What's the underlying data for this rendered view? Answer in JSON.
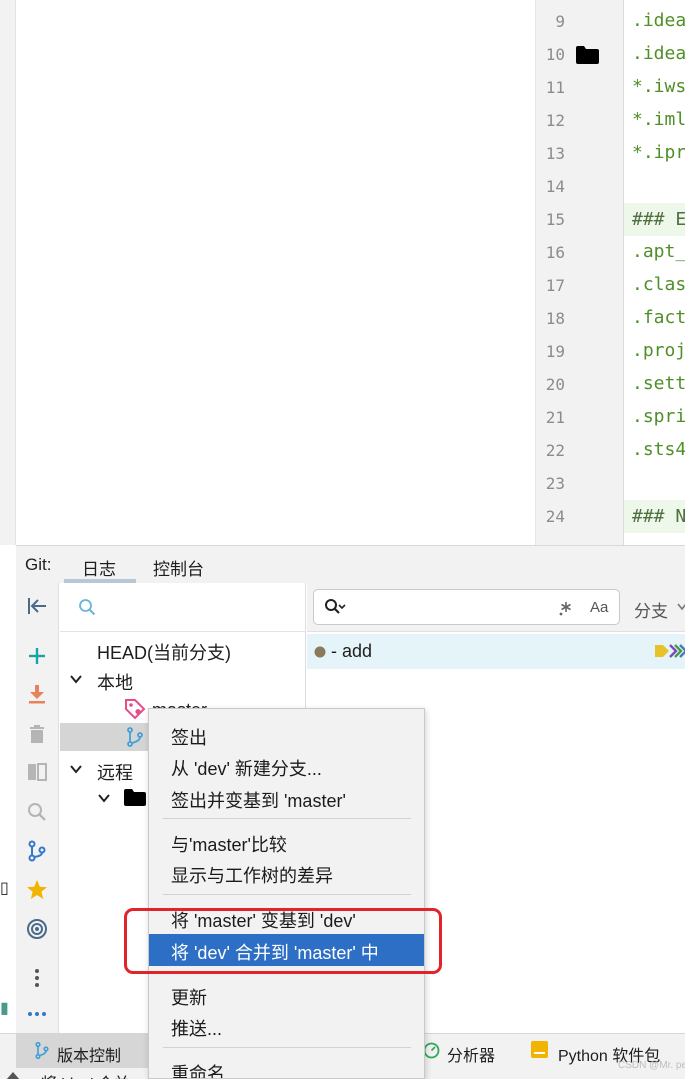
{
  "editor": {
    "line_numbers": [
      "9",
      "10",
      "11",
      "12",
      "13",
      "14",
      "15",
      "16",
      "17",
      "18",
      "19",
      "20",
      "21",
      "22",
      "23",
      "24"
    ],
    "code_lines": [
      ".idea",
      ".idea",
      "*.iws",
      "*.iml",
      "*.ipr",
      "",
      "### E",
      ".apt_",
      ".clas",
      ".fact",
      ".proj",
      ".sett",
      ".spri",
      ".sts4",
      "",
      "### N"
    ]
  },
  "git_panel": {
    "label": "Git:",
    "tabs": [
      "日志",
      "控制台"
    ],
    "branch_search_placeholder": "",
    "tree": {
      "head": "HEAD(当前分支)",
      "local": "本地",
      "master": "master",
      "remote": "远程"
    },
    "log_search_placeholder": "",
    "match_case_label": "Aa",
    "branch_filter_label": "分支",
    "commit_message": "- add"
  },
  "context_menu": {
    "group1": [
      "签出",
      "从 'dev' 新建分支...",
      "签出并变基到 'master'"
    ],
    "group2": [
      "与'master'比较",
      "显示与工作树的差异"
    ],
    "group3": [
      "将 'master' 变基到 'dev'",
      "将 'dev' 合并到 'master' 中"
    ],
    "group4": [
      "更新",
      "推送..."
    ],
    "group5": [
      "重命名..."
    ],
    "highlighted_index": 1
  },
  "bottom_bar": {
    "tabs": [
      "版本控制",
      "分析器",
      "Python 软件包"
    ],
    "status_text": "将 'dev' 合并",
    "watermark": "CSDN @Mr. pen"
  },
  "colors": {
    "menu_highlight": "#2d6fc4",
    "annotation_box": "#e0242a",
    "commit_row": "#e5f4f9",
    "code_text": "#4f8f27"
  }
}
